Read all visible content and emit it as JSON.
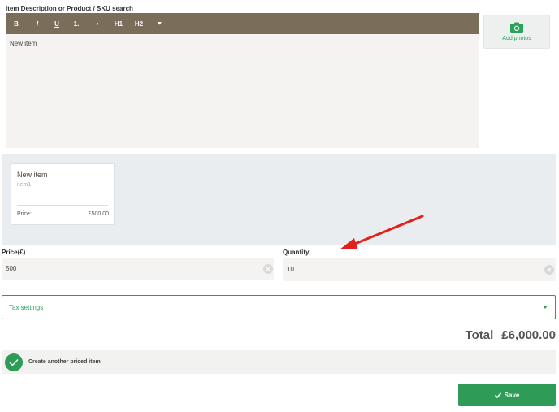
{
  "description": {
    "label": "Item Description or Product / SKU search",
    "content": "New item"
  },
  "toolbar": {
    "bold": "B",
    "italic": "I",
    "underline": "U",
    "ordered_list": "1.",
    "bullet_list": "•",
    "h1": "H1",
    "h2": "H2",
    "more_icon": "caret-down-icon"
  },
  "photos": {
    "label": "Add photos",
    "icon": "camera-icon"
  },
  "card": {
    "title": "New item",
    "sku": "item1",
    "price_label": "Price:",
    "price_value": "£500.00"
  },
  "price": {
    "label": "Price(£)",
    "value": "500"
  },
  "quantity": {
    "label": "Quantity",
    "value": "10"
  },
  "tax": {
    "label": "Tax settings"
  },
  "total": {
    "label": "Total",
    "value": "£6,000.00"
  },
  "create": {
    "label": "Create another priced item"
  },
  "save": {
    "label": "Save"
  },
  "colors": {
    "accent": "#2e9c57",
    "toolbar": "#7a6e5a",
    "annotation_arrow": "#e3201b"
  }
}
